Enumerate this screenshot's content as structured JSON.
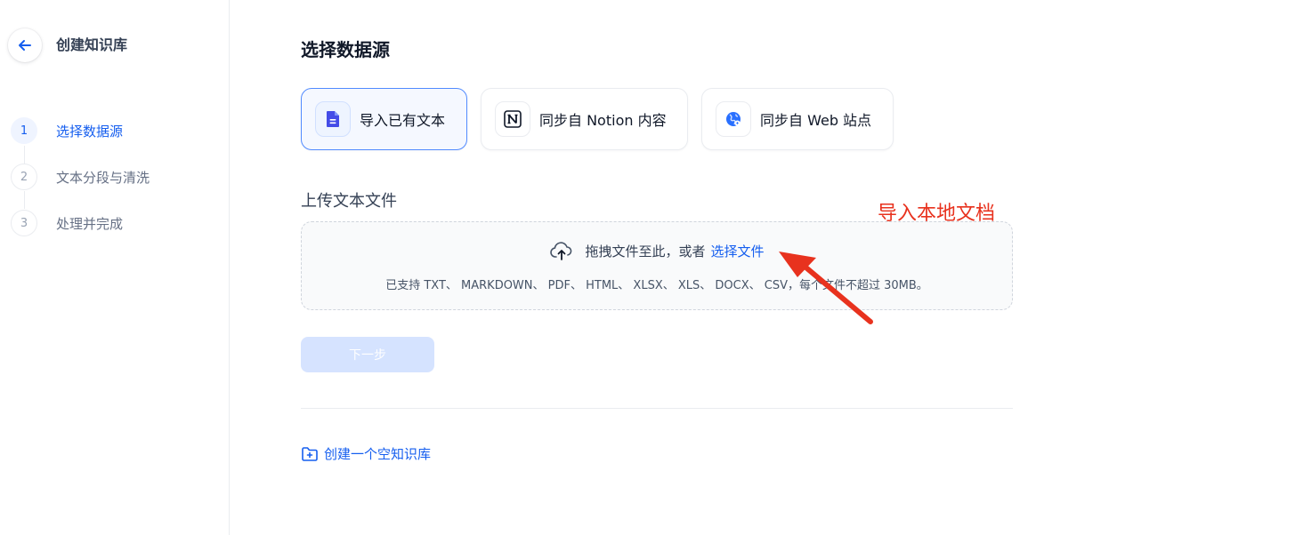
{
  "sidebar": {
    "back_icon": "arrow-left-icon",
    "title": "创建知识库",
    "steps": [
      {
        "num": "1",
        "label": "选择数据源",
        "active": true
      },
      {
        "num": "2",
        "label": "文本分段与清洗",
        "active": false
      },
      {
        "num": "3",
        "label": "处理并完成",
        "active": false
      }
    ]
  },
  "main": {
    "title": "选择数据源",
    "sources": [
      {
        "label": "导入已有文本",
        "icon": "file-text-icon",
        "selected": true
      },
      {
        "label": "同步自 Notion 内容",
        "icon": "notion-icon",
        "selected": false
      },
      {
        "label": "同步自 Web 站点",
        "icon": "globe-icon",
        "selected": false
      }
    ],
    "upload": {
      "section_title": "上传文本文件",
      "drag_text": "拖拽文件至此，或者",
      "select_link": "选择文件",
      "supported": "已支持 TXT、 MARKDOWN、 PDF、 HTML、 XLSX、 XLS、 DOCX、 CSV，每个文件不超过 30MB。"
    },
    "next_button": "下一步",
    "create_empty": "创建一个空知识库"
  },
  "annotation": {
    "text": "导入本地文档",
    "color": "#e8321e"
  },
  "colors": {
    "primary": "#155eef",
    "disabled_button": "#d1e0ff",
    "selected_card_bg": "#f5f8ff"
  }
}
